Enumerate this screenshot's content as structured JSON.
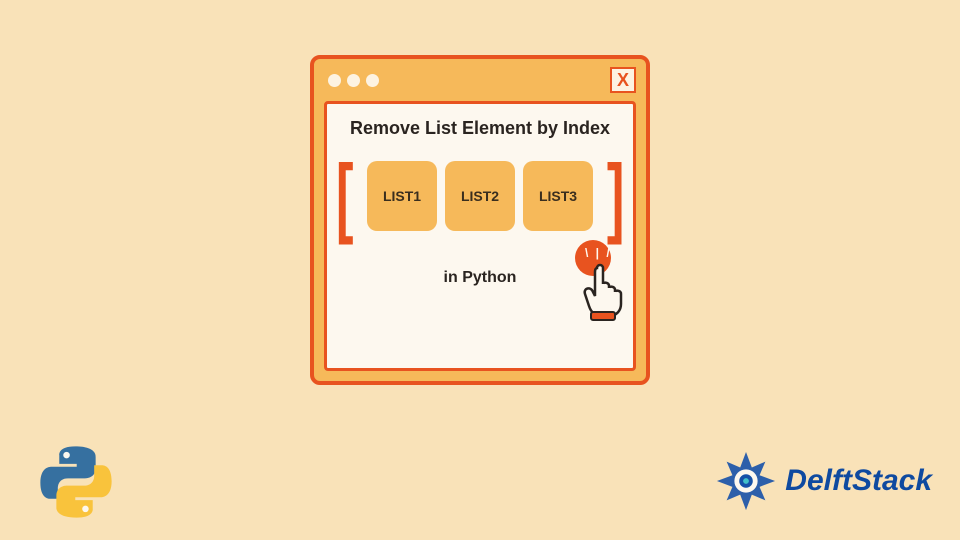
{
  "window": {
    "close_label": "X"
  },
  "content": {
    "heading": "Remove List Element by Index",
    "items": [
      "LIST1",
      "LIST2",
      "LIST3"
    ],
    "subtitle": "in Python"
  },
  "brand": {
    "name": "DelftStack"
  },
  "colors": {
    "background": "#f9e2b8",
    "accent": "#e8531f",
    "panel": "#f6b95a",
    "brand_blue": "#0f4aa0"
  }
}
